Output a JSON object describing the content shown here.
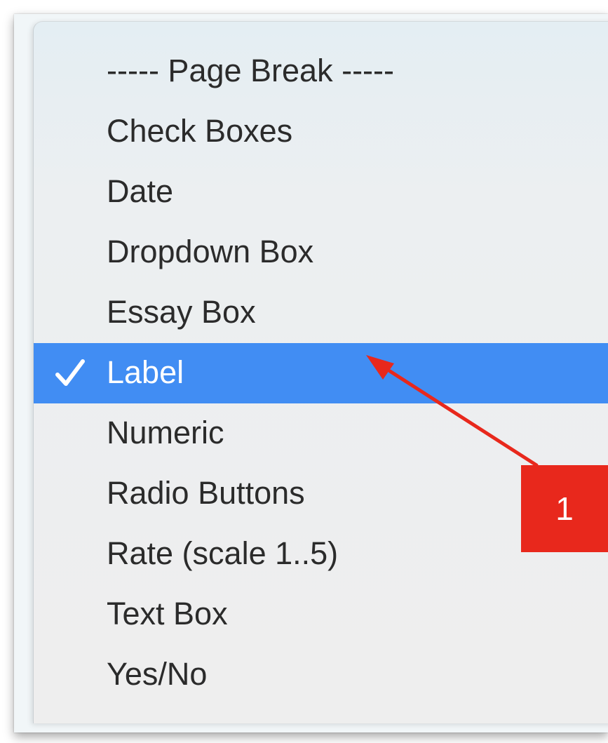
{
  "menu": {
    "items": [
      {
        "label": "----- Page Break -----",
        "selected": false
      },
      {
        "label": "Check Boxes",
        "selected": false
      },
      {
        "label": "Date",
        "selected": false
      },
      {
        "label": "Dropdown Box",
        "selected": false
      },
      {
        "label": "Essay Box",
        "selected": false
      },
      {
        "label": "Label",
        "selected": true
      },
      {
        "label": "Numeric",
        "selected": false
      },
      {
        "label": "Radio Buttons",
        "selected": false
      },
      {
        "label": "Rate (scale 1..5)",
        "selected": false
      },
      {
        "label": "Text Box",
        "selected": false
      },
      {
        "label": "Yes/No",
        "selected": false
      }
    ]
  },
  "annotation": {
    "number": "1",
    "color": "#e8281c"
  },
  "colors": {
    "selection": "#418df3",
    "text": "#2b2b2b"
  }
}
